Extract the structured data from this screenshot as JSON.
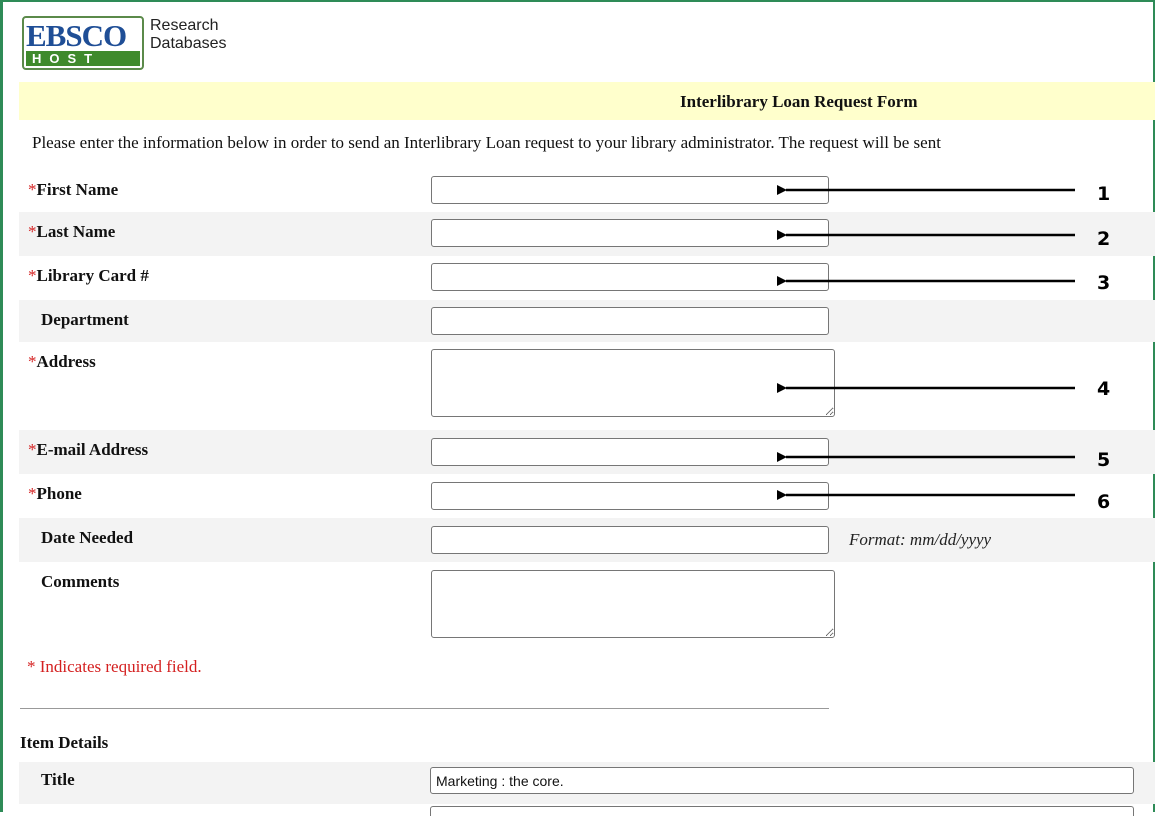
{
  "logo": {
    "top_text": "EBSCO",
    "bottom_text": "HOST",
    "side_line1": "Research",
    "side_line2": "Databases"
  },
  "form": {
    "title": "Interlibrary Loan Request Form",
    "intro": "Please enter the information below in order to send an Interlibrary Loan request to your library administrator. The request will be sent",
    "required_marker": "*",
    "fields": [
      {
        "label": "First Name",
        "required": true,
        "type": "input",
        "value": ""
      },
      {
        "label": "Last Name",
        "required": true,
        "type": "input",
        "value": ""
      },
      {
        "label": "Library Card #",
        "required": true,
        "type": "input",
        "value": ""
      },
      {
        "label": "Department",
        "required": false,
        "type": "input",
        "value": ""
      },
      {
        "label": "Address",
        "required": true,
        "type": "textarea",
        "value": ""
      },
      {
        "label": "E-mail Address",
        "required": true,
        "type": "input",
        "value": ""
      },
      {
        "label": "Phone",
        "required": true,
        "type": "input",
        "value": ""
      },
      {
        "label": "Date Needed",
        "required": false,
        "type": "input",
        "value": "",
        "hint": "Format: mm/dd/yyyy"
      },
      {
        "label": "Comments",
        "required": false,
        "type": "textarea",
        "value": ""
      }
    ],
    "required_note": "* Indicates required field."
  },
  "item_details": {
    "heading": "Item Details",
    "title_label": "Title",
    "title_value": "Marketing : the core."
  },
  "annotations": [
    "1",
    "2",
    "3",
    "4",
    "5",
    "6"
  ],
  "colors": {
    "banner": "#ffffcc",
    "required": "#d42020",
    "frame": "#2e8b57",
    "row_shade": "#f3f3f3"
  }
}
